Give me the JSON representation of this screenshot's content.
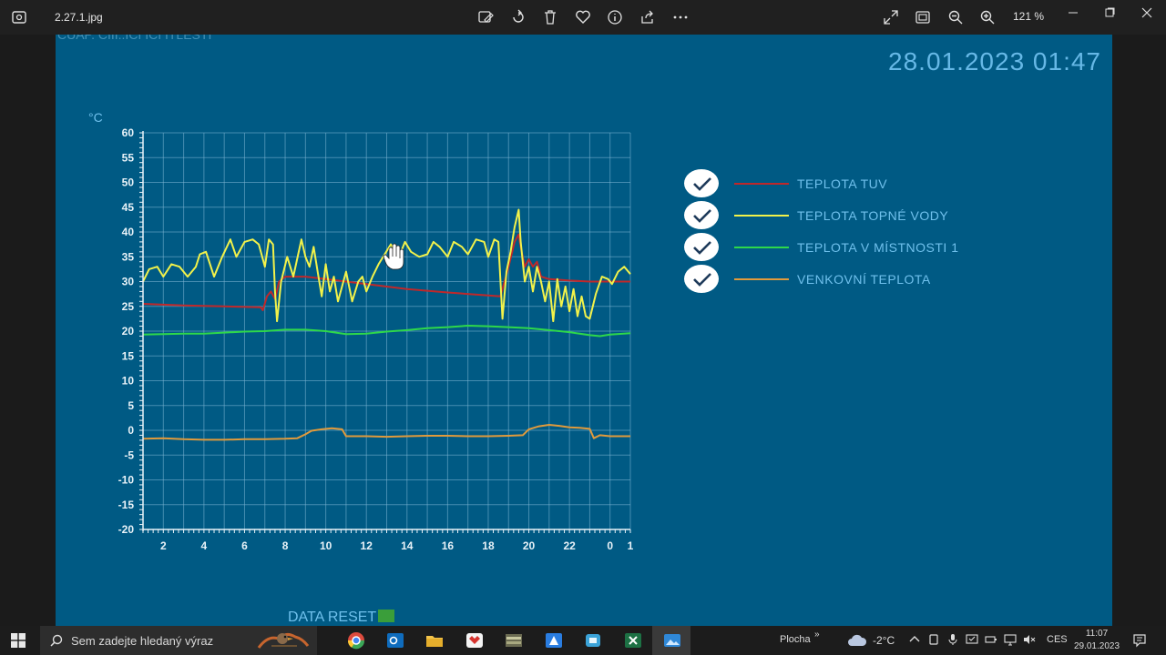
{
  "window": {
    "filename": "2.27.1.jpg",
    "zoom": "121 %"
  },
  "photo": {
    "top_text": "CUAP. CIII..ICI ICI ITLESTI",
    "datetime": "28.01.2023   01:47",
    "data_reset": "DATA RESET"
  },
  "chart_data": {
    "type": "line",
    "ylabel": "°C",
    "ylim": [
      -20,
      60
    ],
    "yticks": [
      60,
      55,
      50,
      45,
      40,
      35,
      30,
      25,
      20,
      15,
      10,
      5,
      0,
      -5,
      -10,
      -15,
      -20
    ],
    "xlim": [
      1,
      25
    ],
    "xticks": [
      {
        "x": 2,
        "label": "2"
      },
      {
        "x": 4,
        "label": "4"
      },
      {
        "x": 6,
        "label": "6"
      },
      {
        "x": 8,
        "label": "8"
      },
      {
        "x": 10,
        "label": "10"
      },
      {
        "x": 12,
        "label": "12"
      },
      {
        "x": 14,
        "label": "14"
      },
      {
        "x": 16,
        "label": "16"
      },
      {
        "x": 18,
        "label": "18"
      },
      {
        "x": 20,
        "label": "20"
      },
      {
        "x": 22,
        "label": "22"
      },
      {
        "x": 24,
        "label": "0"
      },
      {
        "x": 25,
        "label": "1"
      }
    ],
    "grid": true,
    "series": [
      {
        "name": "TEPLOTA TUV",
        "color": "#c0282a",
        "points": [
          [
            1.0,
            25.5
          ],
          [
            3.0,
            25.2
          ],
          [
            5.0,
            25.0
          ],
          [
            6.8,
            24.8
          ],
          [
            6.9,
            24.2
          ],
          [
            7.1,
            27.0
          ],
          [
            7.3,
            28.0
          ],
          [
            7.5,
            26.5
          ],
          [
            7.7,
            30.0
          ],
          [
            8.0,
            31.0
          ],
          [
            9.0,
            31.0
          ],
          [
            10.0,
            30.5
          ],
          [
            12.0,
            29.5
          ],
          [
            14.0,
            28.5
          ],
          [
            16.0,
            27.8
          ],
          [
            18.0,
            27.2
          ],
          [
            18.6,
            27.0
          ],
          [
            18.8,
            30.0
          ],
          [
            19.0,
            33.0
          ],
          [
            19.3,
            38.0
          ],
          [
            19.5,
            39.5
          ],
          [
            19.6,
            37.0
          ],
          [
            19.8,
            33.0
          ],
          [
            20.0,
            34.5
          ],
          [
            20.2,
            33.0
          ],
          [
            20.4,
            34.0
          ],
          [
            20.6,
            31.0
          ],
          [
            21.0,
            30.5
          ],
          [
            22.0,
            30.2
          ],
          [
            23.0,
            30.0
          ],
          [
            24.0,
            30.0
          ],
          [
            25.0,
            30.0
          ]
        ]
      },
      {
        "name": "TEPLOTA TOPNÉ VODY",
        "color": "#f2f24a",
        "points": [
          [
            1.0,
            30.0
          ],
          [
            1.3,
            32.5
          ],
          [
            1.7,
            33.0
          ],
          [
            2.0,
            31.0
          ],
          [
            2.4,
            33.5
          ],
          [
            2.8,
            33.0
          ],
          [
            3.2,
            31.0
          ],
          [
            3.6,
            33.0
          ],
          [
            3.8,
            35.5
          ],
          [
            4.1,
            36.0
          ],
          [
            4.5,
            31.0
          ],
          [
            4.9,
            35.0
          ],
          [
            5.3,
            38.5
          ],
          [
            5.6,
            35.0
          ],
          [
            6.0,
            38.0
          ],
          [
            6.4,
            38.5
          ],
          [
            6.7,
            37.5
          ],
          [
            7.0,
            33.0
          ],
          [
            7.2,
            38.5
          ],
          [
            7.4,
            37.5
          ],
          [
            7.5,
            28.0
          ],
          [
            7.6,
            22.0
          ],
          [
            7.8,
            30.0
          ],
          [
            8.1,
            35.0
          ],
          [
            8.4,
            31.0
          ],
          [
            8.8,
            38.5
          ],
          [
            9.0,
            35.0
          ],
          [
            9.2,
            33.0
          ],
          [
            9.4,
            37.0
          ],
          [
            9.6,
            32.0
          ],
          [
            9.8,
            27.0
          ],
          [
            10.0,
            33.5
          ],
          [
            10.2,
            28.0
          ],
          [
            10.4,
            31.0
          ],
          [
            10.6,
            26.0
          ],
          [
            10.8,
            29.0
          ],
          [
            11.0,
            32.0
          ],
          [
            11.3,
            26.0
          ],
          [
            11.6,
            30.0
          ],
          [
            11.8,
            31.0
          ],
          [
            12.0,
            28.0
          ],
          [
            12.3,
            31.0
          ],
          [
            12.6,
            33.5
          ],
          [
            12.9,
            35.5
          ],
          [
            13.2,
            37.5
          ],
          [
            13.6,
            35.0
          ],
          [
            13.9,
            38.0
          ],
          [
            14.2,
            36.0
          ],
          [
            14.6,
            35.0
          ],
          [
            15.0,
            35.5
          ],
          [
            15.3,
            38.0
          ],
          [
            15.6,
            37.0
          ],
          [
            16.0,
            35.0
          ],
          [
            16.3,
            38.0
          ],
          [
            16.7,
            37.0
          ],
          [
            17.0,
            35.5
          ],
          [
            17.4,
            38.5
          ],
          [
            17.8,
            38.0
          ],
          [
            18.0,
            35.0
          ],
          [
            18.3,
            38.5
          ],
          [
            18.5,
            38.0
          ],
          [
            18.7,
            22.5
          ],
          [
            18.9,
            32.0
          ],
          [
            19.1,
            36.0
          ],
          [
            19.3,
            41.0
          ],
          [
            19.5,
            44.5
          ],
          [
            19.6,
            38.0
          ],
          [
            19.8,
            30.0
          ],
          [
            20.0,
            33.0
          ],
          [
            20.2,
            28.0
          ],
          [
            20.4,
            33.0
          ],
          [
            20.6,
            30.0
          ],
          [
            20.8,
            26.0
          ],
          [
            21.0,
            30.0
          ],
          [
            21.2,
            22.0
          ],
          [
            21.4,
            30.5
          ],
          [
            21.6,
            25.0
          ],
          [
            21.8,
            29.0
          ],
          [
            22.0,
            24.0
          ],
          [
            22.2,
            28.5
          ],
          [
            22.4,
            23.0
          ],
          [
            22.6,
            27.0
          ],
          [
            22.8,
            23.0
          ],
          [
            23.0,
            22.5
          ],
          [
            23.3,
            27.5
          ],
          [
            23.6,
            31.0
          ],
          [
            23.9,
            30.5
          ],
          [
            24.1,
            29.5
          ],
          [
            24.4,
            32.0
          ],
          [
            24.7,
            33.0
          ],
          [
            25.0,
            31.5
          ]
        ]
      },
      {
        "name": "TEPLOTA V MÍSTNOSTI 1",
        "color": "#2ed84a",
        "points": [
          [
            1.0,
            19.3
          ],
          [
            2.0,
            19.4
          ],
          [
            3.0,
            19.5
          ],
          [
            4.0,
            19.5
          ],
          [
            5.0,
            19.7
          ],
          [
            6.0,
            19.9
          ],
          [
            7.0,
            20.0
          ],
          [
            8.0,
            20.3
          ],
          [
            9.0,
            20.3
          ],
          [
            10.0,
            20.0
          ],
          [
            11.0,
            19.4
          ],
          [
            12.0,
            19.5
          ],
          [
            13.0,
            19.9
          ],
          [
            14.0,
            20.2
          ],
          [
            15.0,
            20.6
          ],
          [
            16.0,
            20.8
          ],
          [
            17.0,
            21.1
          ],
          [
            18.0,
            21.0
          ],
          [
            19.0,
            20.8
          ],
          [
            20.0,
            20.6
          ],
          [
            21.0,
            20.2
          ],
          [
            22.0,
            19.8
          ],
          [
            23.0,
            19.2
          ],
          [
            23.5,
            19.0
          ],
          [
            24.0,
            19.3
          ],
          [
            25.0,
            19.6
          ]
        ]
      },
      {
        "name": "VENKOVNÍ TEPLOTA",
        "color": "#e09a3c",
        "points": [
          [
            1.0,
            -1.7
          ],
          [
            2.0,
            -1.6
          ],
          [
            3.0,
            -1.8
          ],
          [
            4.0,
            -1.9
          ],
          [
            5.0,
            -1.9
          ],
          [
            6.0,
            -1.8
          ],
          [
            7.0,
            -1.8
          ],
          [
            8.0,
            -1.7
          ],
          [
            8.6,
            -1.6
          ],
          [
            9.0,
            -0.8
          ],
          [
            9.3,
            -0.1
          ],
          [
            9.8,
            0.2
          ],
          [
            10.3,
            0.4
          ],
          [
            10.8,
            0.2
          ],
          [
            11.0,
            -1.2
          ],
          [
            12.0,
            -1.2
          ],
          [
            13.0,
            -1.3
          ],
          [
            14.0,
            -1.2
          ],
          [
            15.0,
            -1.1
          ],
          [
            16.0,
            -1.1
          ],
          [
            17.0,
            -1.2
          ],
          [
            18.0,
            -1.2
          ],
          [
            19.0,
            -1.1
          ],
          [
            19.7,
            -1.0
          ],
          [
            20.0,
            0.2
          ],
          [
            20.5,
            0.8
          ],
          [
            21.0,
            1.1
          ],
          [
            21.5,
            0.9
          ],
          [
            22.0,
            0.6
          ],
          [
            22.5,
            0.5
          ],
          [
            23.0,
            0.3
          ],
          [
            23.2,
            -1.6
          ],
          [
            23.5,
            -1.0
          ],
          [
            24.0,
            -1.2
          ],
          [
            25.0,
            -1.2
          ]
        ]
      }
    ]
  },
  "legend": {
    "items": [
      {
        "label": "TEPLOTA TUV",
        "color": "#c0282a"
      },
      {
        "label": "TEPLOTA TOPNÉ VODY",
        "color": "#f2f24a"
      },
      {
        "label": "TEPLOTA V MÍSTNOSTI 1",
        "color": "#2ed84a"
      },
      {
        "label": "VENKOVNÍ TEPLOTA",
        "color": "#e09a3c"
      }
    ]
  },
  "taskbar": {
    "search_placeholder": "Sem zadejte hledaný výraz",
    "desktop_label": "Plocha",
    "weather_temp": "-2°C",
    "language": "CES",
    "time": "11:07",
    "date": "29.01.2023"
  }
}
